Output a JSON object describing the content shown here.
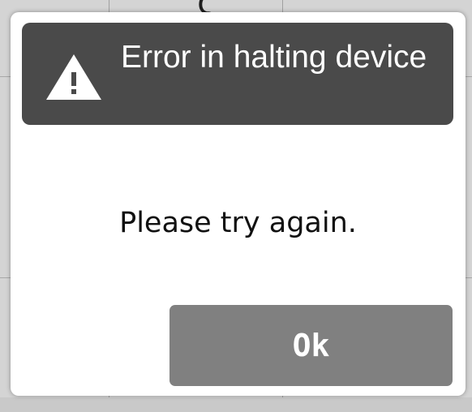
{
  "dialog": {
    "title": "Error in halting device",
    "icon": "warning-triangle-icon",
    "message": "Please try again.",
    "ok_label": "Ok"
  },
  "colors": {
    "header_bg": "#4a4a4a",
    "dialog_bg": "#ffffff",
    "button_bg": "#808080",
    "text_dark": "#111111",
    "text_light": "#ffffff"
  }
}
